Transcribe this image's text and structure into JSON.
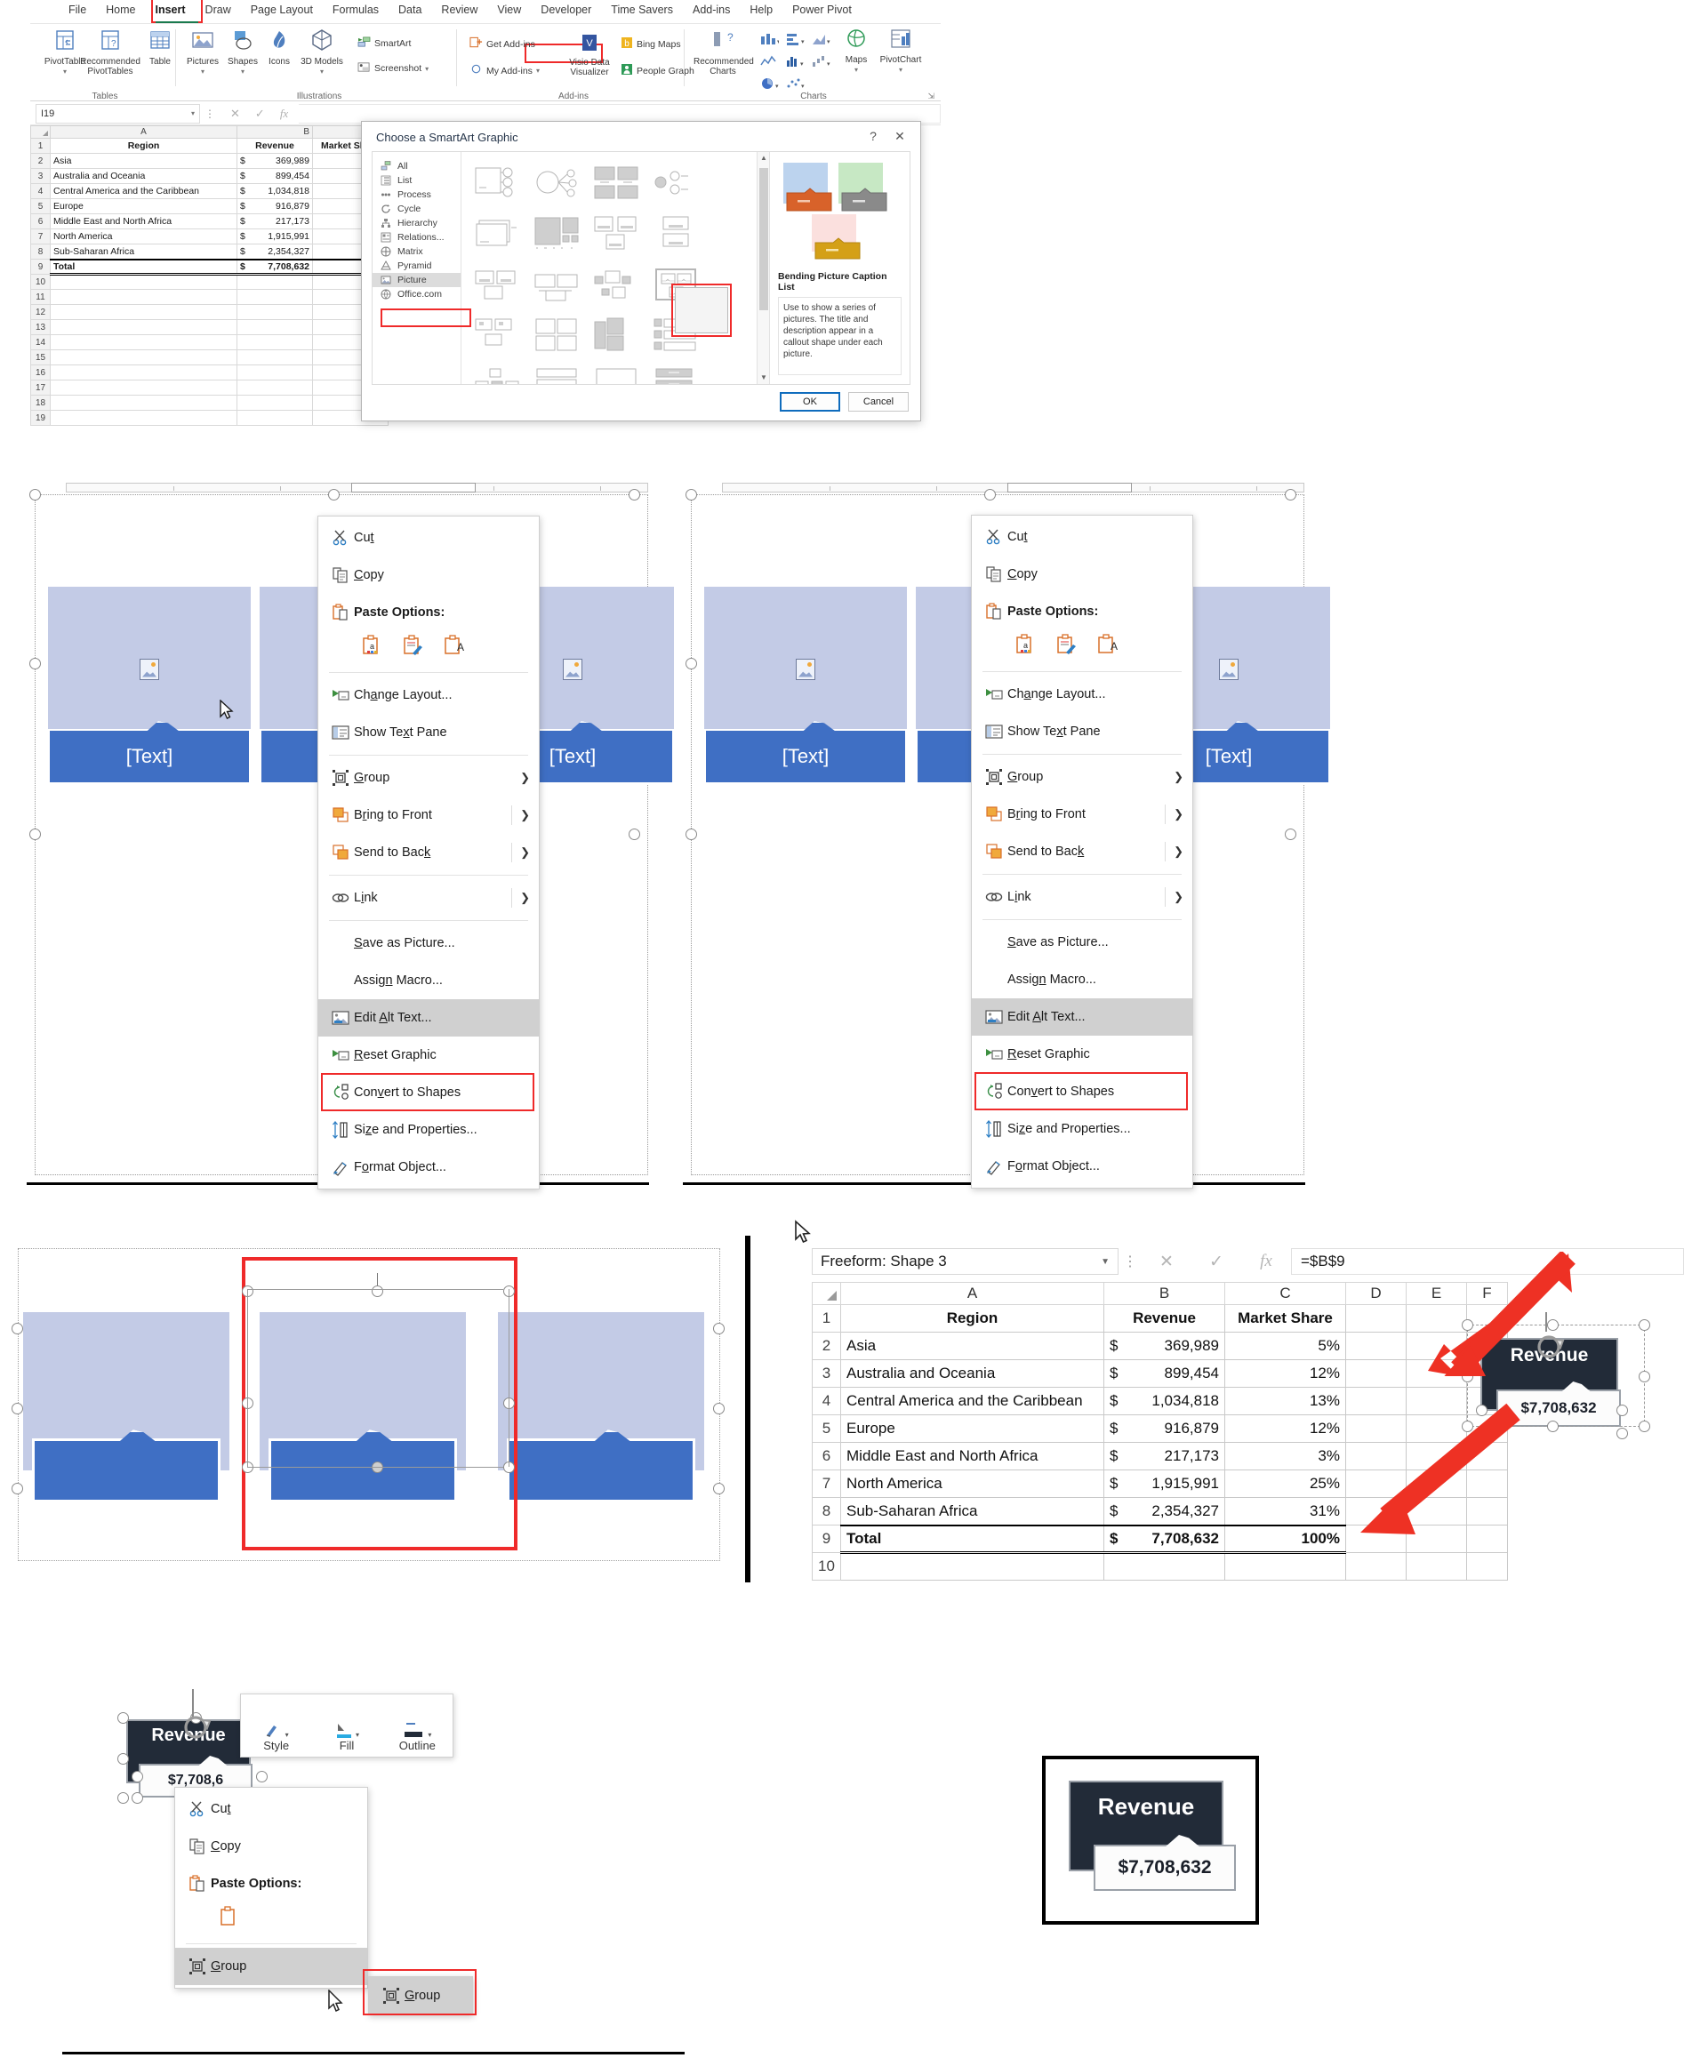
{
  "app": {
    "ribbon_tabs": [
      "File",
      "Home",
      "Insert",
      "Draw",
      "Page Layout",
      "Formulas",
      "Data",
      "Review",
      "View",
      "Developer",
      "Time Savers",
      "Add-ins",
      "Help",
      "Power Pivot"
    ],
    "active_tab": "Insert",
    "groups": {
      "tables": {
        "label": "Tables",
        "buttons": [
          "PivotTable",
          "Recommended PivotTables",
          "Table"
        ]
      },
      "illustrations": {
        "label": "Illustrations",
        "buttons": [
          "Pictures",
          "Shapes",
          "Icons",
          "3D Models"
        ],
        "small_buttons": [
          "SmartArt",
          "Screenshot"
        ]
      },
      "addins": {
        "label": "Add-ins",
        "buttons": [
          "Get Add-ins",
          "My Add-ins",
          "Bing Maps",
          "People Graph",
          "Visio Data Visualizer"
        ]
      },
      "charts": {
        "label": "Charts",
        "buttons": [
          "Recommended Charts",
          "Maps",
          "PivotChart"
        ]
      }
    }
  },
  "formula_bar": {
    "name_box": "I19",
    "formula": "",
    "cancel_icon": "cancel-icon",
    "enter_icon": "enter-icon",
    "fx_icon": "function-icon"
  },
  "sheet": {
    "columns": [
      "A",
      "B",
      "C"
    ],
    "headers": [
      "Region",
      "Revenue",
      "Market Share"
    ],
    "rows": [
      {
        "n": "1",
        "region": "Region",
        "revenue": "Revenue",
        "share": "Market Share",
        "header": true
      },
      {
        "n": "2",
        "region": "Asia",
        "cur": "$",
        "revenue": "369,989",
        "share": "5%"
      },
      {
        "n": "3",
        "region": "Australia and Oceania",
        "cur": "$",
        "revenue": "899,454",
        "share": "12%"
      },
      {
        "n": "4",
        "region": "Central America and the Caribbean",
        "cur": "$",
        "revenue": "1,034,818",
        "share": "13%"
      },
      {
        "n": "5",
        "region": "Europe",
        "cur": "$",
        "revenue": "916,879",
        "share": "12%"
      },
      {
        "n": "6",
        "region": "Middle East and North Africa",
        "cur": "$",
        "revenue": "217,173",
        "share": "3%"
      },
      {
        "n": "7",
        "region": "North America",
        "cur": "$",
        "revenue": "1,915,991",
        "share": "25%"
      },
      {
        "n": "8",
        "region": "Sub-Saharan Africa",
        "cur": "$",
        "revenue": "2,354,327",
        "share": "31%"
      },
      {
        "n": "9",
        "region": "Total",
        "cur": "$",
        "revenue": "7,708,632",
        "share": "100%",
        "total": true
      }
    ],
    "empty_rows": [
      "10",
      "11",
      "12",
      "13",
      "14",
      "15",
      "16",
      "17",
      "18",
      "19"
    ]
  },
  "smartart_dialog": {
    "title": "Choose a SmartArt Graphic",
    "help_icon": "help-icon",
    "close_icon": "close-icon",
    "categories": [
      "All",
      "List",
      "Process",
      "Cycle",
      "Hierarchy",
      "Relations...",
      "Matrix",
      "Pyramid",
      "Picture",
      "Office.com"
    ],
    "selected_category": "Picture",
    "preview": {
      "name": "Bending Picture Caption List",
      "description": "Use to show a series of pictures. The title and description appear in a callout shape under each picture."
    },
    "buttons": {
      "ok": "OK",
      "cancel": "Cancel"
    }
  },
  "context_menu": {
    "items": [
      {
        "label": "Cut",
        "icon": "scissors-icon",
        "accel": "t"
      },
      {
        "label": "Copy",
        "icon": "copy-icon",
        "accel": "C"
      },
      {
        "label": "Paste Options:",
        "icon": "clipboard-icon",
        "bold": true
      },
      {
        "label": "Change Layout...",
        "icon": "change-layout-icon",
        "accel": "a"
      },
      {
        "label": "Show Text Pane",
        "icon": "text-pane-icon",
        "accel": "x"
      },
      {
        "label": "Group",
        "icon": "group-icon",
        "accel": "G",
        "submenu": true
      },
      {
        "label": "Bring to Front",
        "icon": "bring-front-icon",
        "accel": "r",
        "submenu": true,
        "divider": true
      },
      {
        "label": "Send to Back",
        "icon": "send-back-icon",
        "accel": "k",
        "submenu": true,
        "divider": true
      },
      {
        "label": "Link",
        "icon": "link-icon",
        "accel": "i",
        "submenu": true,
        "divider": true
      },
      {
        "label": "Save as Picture...",
        "icon": "none",
        "accel": "S"
      },
      {
        "label": "Assign Macro...",
        "icon": "none",
        "accel": "n"
      },
      {
        "label": "Edit Alt Text...",
        "icon": "alt-text-icon",
        "accel": "A",
        "highlighted": true
      },
      {
        "label": "Reset Graphic",
        "icon": "reset-graphic-icon",
        "accel": "R"
      },
      {
        "label": "Convert to Shapes",
        "icon": "convert-shapes-icon",
        "accel": "v",
        "redbox": true
      },
      {
        "label": "Size and Properties...",
        "icon": "size-props-icon",
        "accel": "z"
      },
      {
        "label": "Format Object...",
        "icon": "format-object-icon",
        "accel": "o"
      }
    ],
    "paste_options": [
      "paste-keep-source-icon",
      "paste-values-icon",
      "paste-formatting-icon"
    ]
  },
  "smartart_canvas": {
    "placeholder_text": "[Text]",
    "card_count": 3
  },
  "panel5": {
    "name_box": "Freeform: Shape 3",
    "formula": "=$B$9",
    "columns": [
      "A",
      "B",
      "C",
      "D",
      "E",
      "F"
    ],
    "rows": [
      {
        "n": "1",
        "a": "Region",
        "b": "Revenue",
        "c": "Market Share",
        "header": true
      },
      {
        "n": "2",
        "a": "Asia",
        "cur": "$",
        "b": "369,989",
        "c": "5%"
      },
      {
        "n": "3",
        "a": "Australia and Oceania",
        "cur": "$",
        "b": "899,454",
        "c": "12%"
      },
      {
        "n": "4",
        "a": "Central America and the Caribbean",
        "cur": "$",
        "b": "1,034,818",
        "c": "13%"
      },
      {
        "n": "5",
        "a": "Europe",
        "cur": "$",
        "b": "916,879",
        "c": "12%"
      },
      {
        "n": "6",
        "a": "Middle East and North Africa",
        "cur": "$",
        "b": "217,173",
        "c": "3%"
      },
      {
        "n": "7",
        "a": "North America",
        "cur": "$",
        "b": "1,915,991",
        "c": "25%"
      },
      {
        "n": "8",
        "a": "Sub-Saharan Africa",
        "cur": "$",
        "b": "2,354,327",
        "c": "31%"
      },
      {
        "n": "9",
        "a": "Total",
        "cur": "$",
        "b": "7,708,632",
        "c": "100%",
        "total": true
      },
      {
        "n": "10",
        "a": "",
        "b": "",
        "c": ""
      }
    ],
    "shape": {
      "title": "Revenue",
      "value": "$7,708,632"
    }
  },
  "panel6": {
    "mini_toolbar": {
      "items": [
        {
          "label": "Style",
          "icon": "shape-style-icon"
        },
        {
          "label": "Fill",
          "icon": "shape-fill-icon"
        },
        {
          "label": "Outline",
          "icon": "shape-outline-icon"
        }
      ]
    },
    "menu_items": [
      {
        "label": "Cut",
        "icon": "scissors-icon",
        "accel": "t"
      },
      {
        "label": "Copy",
        "icon": "copy-icon",
        "accel": "C"
      },
      {
        "label": "Paste Options:",
        "icon": "clipboard-icon",
        "bold": true
      },
      {
        "label": "Group",
        "icon": "group-icon",
        "accel": "G",
        "highlighted": true
      }
    ],
    "submenu": [
      {
        "label": "Group",
        "icon": "group-icon",
        "accel": "G",
        "redbox": true
      }
    ],
    "shape": {
      "title": "Revenue",
      "value": "$7,708,6"
    }
  },
  "panel7": {
    "shape": {
      "title": "Revenue",
      "value": "$7,708,632"
    }
  },
  "colors": {
    "accent_blue": "#3f6fc4",
    "pic_fill": "#c3cbe6",
    "highlight_red": "#ef2a2a",
    "dark_shape": "#222b38",
    "tab_green": "#1a7a4e"
  }
}
